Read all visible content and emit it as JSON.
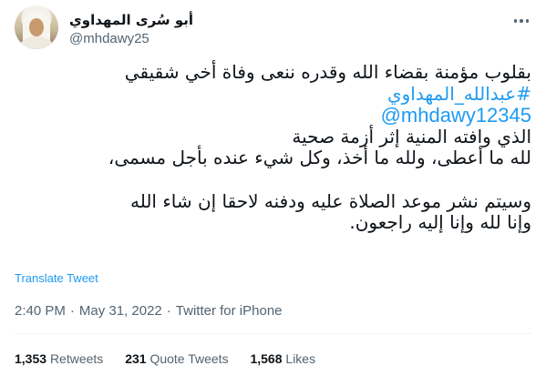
{
  "author": {
    "display_name": "أبو سُرى المهداوي",
    "handle": "@mhdawy25"
  },
  "tweet": {
    "lines": [
      {
        "text": "بقلوب مؤمنة بقضاء الله وقدره ننعى وفاة أخي شقيقي",
        "type": "text"
      },
      {
        "text": "#عبدالله_المهداوي",
        "type": "hashtag"
      },
      {
        "text": "@mhdawy12345",
        "type": "mention"
      },
      {
        "text": "الذي وافته المنية إثر أزمة صحية",
        "type": "text"
      },
      {
        "text": "لله ما أعطى، ولله ما أخذ، وكل شيء عنده بأجل مسمى،",
        "type": "text"
      },
      {
        "text": "",
        "type": "blank"
      },
      {
        "text": "وسيتم نشر موعد الصلاة عليه ودفنه لاحقا إن شاء الله",
        "type": "text"
      },
      {
        "text": "وإنا لله وإنا إليه راجعون.",
        "type": "text"
      }
    ],
    "translate_label": "Translate Tweet",
    "time": "2:40 PM",
    "date": "May 31, 2022",
    "separator": "·",
    "source": "Twitter for iPhone"
  },
  "stats": {
    "retweets_count": "1,353",
    "retweets_label": "Retweets",
    "quotes_count": "231",
    "quotes_label": "Quote Tweets",
    "likes_count": "1,568",
    "likes_label": "Likes"
  },
  "colors": {
    "link": "#1d9bf0",
    "secondary": "#536471",
    "primary": "#0f1419",
    "divider": "#eff3f4"
  },
  "icons": {
    "more": "more-horizontal-icon"
  }
}
